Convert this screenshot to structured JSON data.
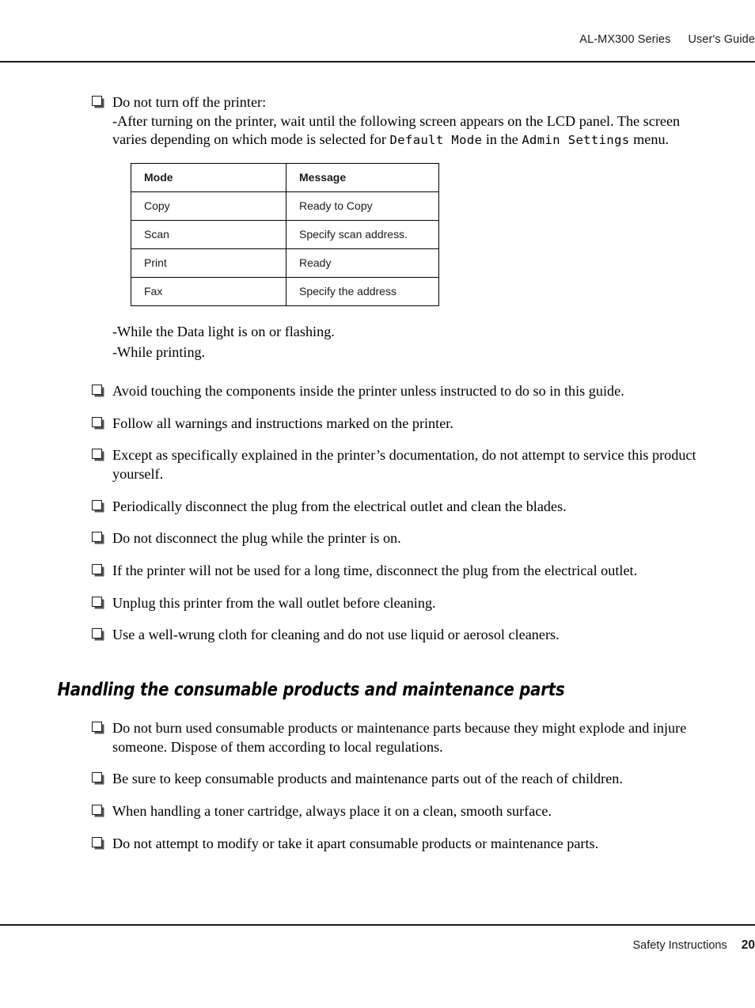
{
  "header": {
    "model": "AL-MX300 Series",
    "doc_title": "User's Guide"
  },
  "footer": {
    "section": "Safety Instructions",
    "page_number": "20"
  },
  "main": {
    "first_bullet": {
      "line1": "Do not turn off the printer:",
      "line2_a": "-After turning on the printer, wait until the following screen appears on the LCD panel. The screen",
      "line3_a": "varies depending on which mode is selected for ",
      "mono1": "Default Mode",
      "line3_b": " in the ",
      "mono2": "Admin Settings",
      "line3_c": " menu."
    },
    "mode_table": {
      "columns": [
        "Mode",
        "Message"
      ],
      "rows": [
        [
          "Copy",
          "Ready to Copy"
        ],
        [
          "Scan",
          "Specify scan address."
        ],
        [
          "Print",
          "Ready"
        ],
        [
          "Fax",
          "Specify the address"
        ]
      ]
    },
    "dash_items": [
      "-While the Data light is on or flashing.",
      "-While printing."
    ],
    "bullets": [
      "Avoid touching the components inside the printer unless instructed to do so in this guide.",
      "Follow all warnings and instructions marked on the printer.",
      "Except as specifically explained in the printer’s documentation, do not attempt to service this product yourself.",
      "Periodically disconnect the plug from the electrical outlet and clean the blades.",
      "Do not disconnect the plug while the printer is on.",
      "If the printer will not be used for a long time, disconnect the plug from the electrical outlet.",
      "Unplug this printer from the wall outlet before cleaning.",
      "Use a well-wrung cloth for cleaning and do not use liquid or aerosol cleaners."
    ],
    "section_heading": "Handling the consumable products and maintenance parts",
    "section_bullets": [
      "Do not burn used consumable products or maintenance parts because they might explode and injure someone. Dispose of them according to local regulations.",
      "Be sure to keep consumable products and maintenance parts out of the reach of children.",
      "When handling a toner cartridge, always place it on a clean, smooth surface.",
      "Do not attempt to modify or take it apart consumable products or maintenance parts."
    ]
  }
}
